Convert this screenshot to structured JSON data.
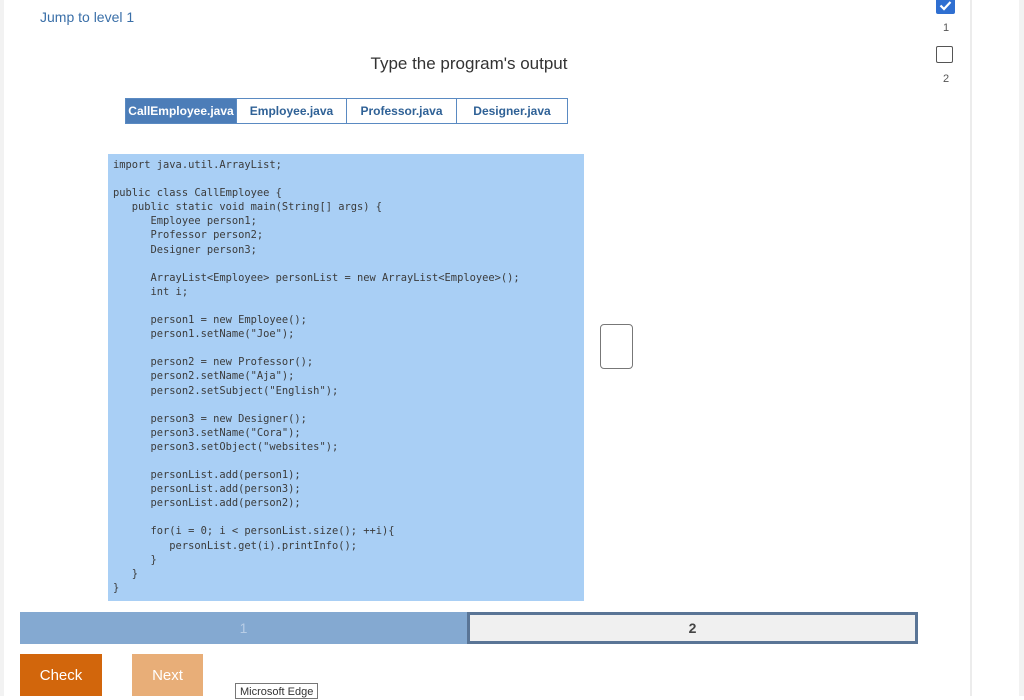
{
  "header": {
    "jump_link": "Jump to level 1",
    "title": "Type the program's output"
  },
  "tabs": [
    {
      "label": "CallEmployee.java",
      "active": true
    },
    {
      "label": "Employee.java",
      "active": false
    },
    {
      "label": "Professor.java",
      "active": false
    },
    {
      "label": "Designer.java",
      "active": false
    }
  ],
  "code_lines": [
    "import java.util.ArrayList;",
    "",
    "public class CallEmployee {",
    "   public static void main(String[] args) {",
    "      Employee person1;",
    "      Professor person2;",
    "      Designer person3;",
    "",
    "      ArrayList<Employee> personList = new ArrayList<Employee>();",
    "      int i;",
    "",
    "      person1 = new Employee();",
    "      person1.setName(\"Joe\");",
    "",
    "      person2 = new Professor();",
    "      person2.setName(\"Aja\");",
    "      person2.setSubject(\"English\");",
    "",
    "      person3 = new Designer();",
    "      person3.setName(\"Cora\");",
    "      person3.setObject(\"websites\");",
    "",
    "      personList.add(person1);",
    "      personList.add(person3);",
    "      personList.add(person2);",
    "",
    "      for(i = 0; i < personList.size(); ++i){",
    "         personList.get(i).printInfo();",
    "      }",
    "   }",
    "}"
  ],
  "answer": {
    "value": ""
  },
  "progress": {
    "segments": [
      "1",
      "2"
    ],
    "current": "2"
  },
  "buttons": {
    "check": "Check",
    "next": "Next"
  },
  "tooltip": "Microsoft Edge",
  "levels": {
    "first": "1",
    "second": "2",
    "first_done": true
  },
  "colors": {
    "accent": "#4c7db8",
    "check": "#d2660c",
    "next": "#e8ae78",
    "code_bg": "#a9cff5"
  }
}
